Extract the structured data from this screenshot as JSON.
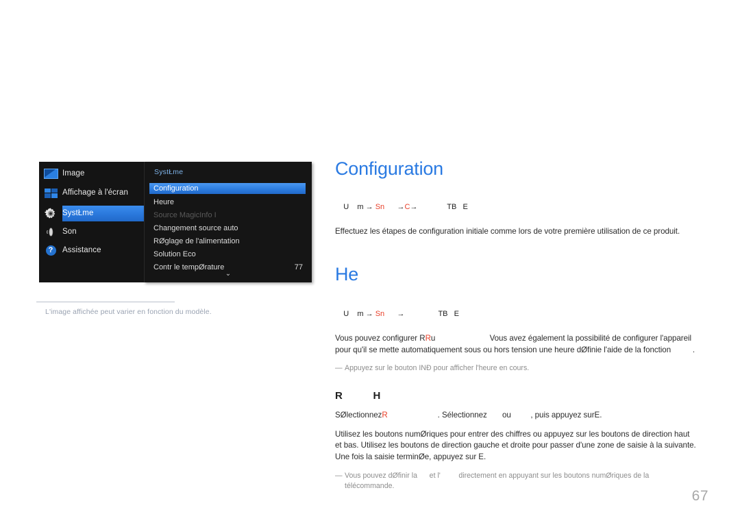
{
  "page": {
    "number": "67"
  },
  "osd": {
    "categories": [
      {
        "label": "Image",
        "icon": "image-icon",
        "selected": false
      },
      {
        "label": "Affichage à l'écran",
        "icon": "osd-grid-icon",
        "selected": false
      },
      {
        "label": "SystŁme",
        "icon": "gear-icon",
        "selected": true
      },
      {
        "label": "Son",
        "icon": "sound-icon",
        "selected": false
      },
      {
        "label": "Assistance",
        "icon": "help-icon",
        "selected": false
      }
    ],
    "submenu_title": "SystŁme",
    "items": [
      {
        "label": "Configuration",
        "value": "",
        "state": "highlighted"
      },
      {
        "label": "Heure",
        "value": "",
        "state": "normal"
      },
      {
        "label": "Source MagicInfo I",
        "value": "",
        "state": "disabled"
      },
      {
        "label": "Changement source auto",
        "value": "",
        "state": "normal"
      },
      {
        "label": "RØglage de l'alimentation",
        "value": "",
        "state": "normal"
      },
      {
        "label": "Solution Eco",
        "value": "",
        "state": "normal"
      },
      {
        "label": "Contr le tempØrature",
        "value": "77",
        "state": "normal"
      }
    ],
    "scroll_indicator": "⌄",
    "caption": "L'image affichée peut varier en fonction du modèle."
  },
  "content": {
    "section1": {
      "heading": "Configuration",
      "breadcrumb_plain_1": "U",
      "breadcrumb_plain_2": "m →",
      "breadcrumb_red_1": "Sn",
      "breadcrumb_arrow": "→",
      "breadcrumb_red_2": "C",
      "breadcrumb_tail": "TB   E",
      "paragraph": "Effectuez les étapes de configuration initiale comme lors de votre première utilisation de ce produit."
    },
    "section2": {
      "heading": "He",
      "breadcrumb_plain_1": "U",
      "breadcrumb_plain_2": "m →",
      "breadcrumb_red_1": "Sn",
      "breadcrumb_arrow": "→",
      "breadcrumb_red_2": "",
      "breadcrumb_tail": "TB   E",
      "paragraph_a": "Vous pouvez configurer R",
      "paragraph_a_red": "R",
      "paragraph_a_mid": "u",
      "paragraph_b": "Vous avez également la possibilité de configurer l'appareil pour qu'il se mette automatiquement sous ou hors tension   une heure dØfinie   l'aide de la fonction",
      "paragraph_b_red": "",
      "note": "Appuyez sur le bouton INÐ pour afficher l'heure en cours."
    },
    "section3": {
      "heading_part1": "R",
      "heading_part2": "H",
      "line1_a": "SØlectionnez",
      "line1_red1": "R",
      "line1_b": ". Sélectionnez",
      "line1_red2": "",
      "line1_c": "ou",
      "line1_red3": "",
      "line1_d": ", puis appuyez sur",
      "line1_e": "E.",
      "paragraph": "Utilisez les boutons numØriques pour entrer des chiffres ou appuyez sur les boutons de direction haut et bas. Utilisez les boutons de direction gauche et droite pour passer d'une zone de saisie à la suivante. Une fois la saisie terminØe, appuyez sur E.",
      "note_a": "Vous pouvez dØfinir la",
      "note_red1": "",
      "note_b": "et l'",
      "note_red2": "",
      "note_c": "directement en appuyant sur les boutons numØriques de la",
      "note_d": "télécommande."
    }
  },
  "colors": {
    "accent_blue": "#2a7ae2",
    "red": "#e8402a",
    "osd_bg": "#141414",
    "osd_select": "#2d7de0",
    "note_gray": "#8d8d8d"
  }
}
